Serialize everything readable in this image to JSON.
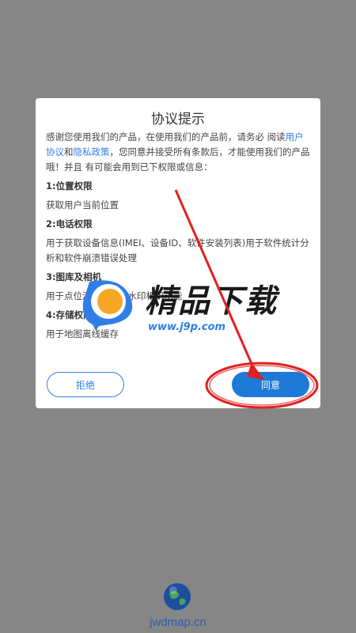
{
  "dialog": {
    "title": "协议提示",
    "intro_pre": "感谢您使用我们的产品，在使用我们的产品前，请务必 阅读",
    "link_user_agreement": "用户协议",
    "and": "和",
    "link_privacy": "隐私政策",
    "intro_post": "，您同意并接受所有条款后，才能使用我们的产品哦！并且 有可能会用到已下权限或信息：",
    "sections": [
      {
        "title": "1:位置权限",
        "desc": "获取用户当前位置"
      },
      {
        "title": "2:电话权限",
        "desc": "用于获取设备信息(IMEI、设备ID、软件安装列表)用于软件统计分析和软件崩溃错误处理"
      },
      {
        "title": "3:图库及相机",
        "desc": "用于点位添加照片及水印相机功能"
      },
      {
        "title": "4:存储权限",
        "desc": "用于地图离线缓存"
      }
    ],
    "reject_label": "拒绝",
    "agree_label": "同意"
  },
  "watermark": {
    "title": "精品下载",
    "url": "www.j9p.com"
  },
  "footer": {
    "site": "jwdmap.cn"
  },
  "colors": {
    "overlay": "#868686",
    "accent": "#1e7ad6",
    "link": "#2f7ee8",
    "annotation": "#e02020"
  }
}
